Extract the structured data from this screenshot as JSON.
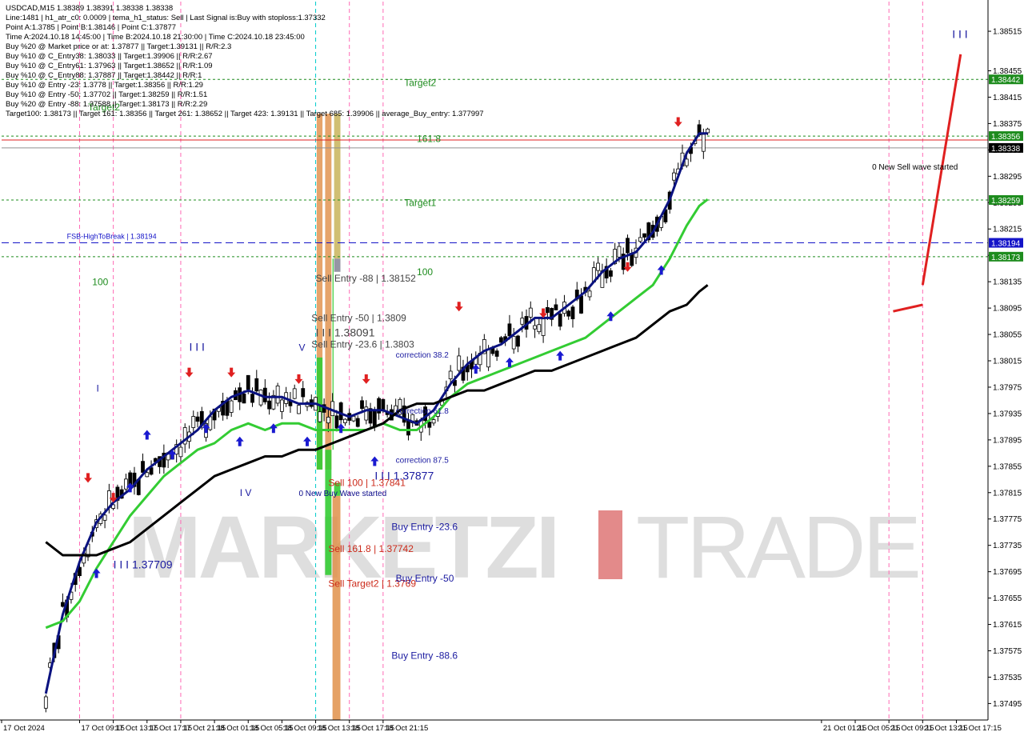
{
  "info_panel": {
    "lines": [
      "USDCAD,M15  1.38389 1.38391 1.38338 1.38338",
      "Line:1481  |  h1_atr_c0: 0.0009  |  tema_h1_status: Sell  |  Last Signal is:Buy with stoploss:1.37332",
      "Point A:1.3785  |  Point B:1.38146  |  Point C:1.37877",
      "Time A:2024.10.18 14:45:00  |  Time B:2024.10.18 21:30:00  |  Time C:2024.10.18 23:45:00",
      "Buy %20 @ Market price or at: 1.37877  ||  Target:1.39131  ||  R/R:2.3",
      "Buy %10 @ C_Entry38: 1.38033  ||  Target:1.39906  ||  R/R:2.67",
      "Buy %10 @ C_Entry61: 1.37963  ||  Target:1.38652  ||  R/R:1.09",
      "Buy %10 @ C_Entry88: 1.37887  ||  Target:1.38442  ||  R/R:1",
      "Buy %10 @ Entry -23: 1.3778  ||  Target:1.38356  ||  R/R:1.29",
      "Buy %10 @ Entry -50: 1.37702  ||  Target:1.38259  ||  R/R:1.51",
      "Buy %20 @ Entry -88: 1.37588  ||  Target:1.38173  ||  R/R:2.29",
      "Target100: 1.38173  ||  Target 161: 1.38356  ||  Target 261: 1.38652  ||  Target 423: 1.39131  ||  Target 685: 1.39906  ||  average_Buy_entry: 1.377997"
    ]
  },
  "watermark": {
    "left": "MARKETZI",
    "right": "TRADE"
  },
  "colors": {
    "accent_green": "#1e8c1e",
    "bright_green": "#33cc33",
    "sell_orange": "#e0904a",
    "olive": "#c8b45a",
    "navy": "#0a1280",
    "label_blue": "#1a1aa0",
    "label_red": "#cc2a1a",
    "fsb_blue": "#1414c8",
    "current_price_red": "#e02020"
  },
  "chart_data": {
    "type": "candlestick",
    "symbol": "USDCAD",
    "timeframe": "M15",
    "ohlc_header": {
      "open": 1.38389,
      "high": 1.38391,
      "low": 1.38338,
      "close": 1.38338
    },
    "current_price": "1.38338",
    "ylim": [
      1.3747,
      1.3856
    ],
    "y_ticks": [
      "1.38515",
      "1.38455",
      "1.38415",
      "1.38375",
      "1.38335",
      "1.38295",
      "1.38255",
      "1.38215",
      "1.38175",
      "1.38135",
      "1.38095",
      "1.38055",
      "1.38015",
      "1.37975",
      "1.37935",
      "1.37895",
      "1.37855",
      "1.37815",
      "1.37775",
      "1.37735",
      "1.37695",
      "1.37655",
      "1.37615",
      "1.37575",
      "1.37535",
      "1.37495"
    ],
    "x_ticks": [
      "17 Oct 2024",
      "17 Oct 09:15",
      "17 Oct 13:15",
      "17 Oct 17:15",
      "17 Oct 21:15",
      "18 Oct 01:15",
      "18 Oct 05:15",
      "18 Oct 09:15",
      "18 Oct 13:15",
      "18 Oct 17:15",
      "18 Oct 21:15",
      "21 Oct 01:15",
      "21 Oct 05:15",
      "21 Oct 09:15",
      "21 Oct 13:15",
      "21 Oct 17:15"
    ],
    "price_boxes": [
      {
        "label": "1.38442",
        "value": 1.38442,
        "color": "#1e8c1e"
      },
      {
        "label": "1.38356",
        "value": 1.38356,
        "color": "#1e8c1e"
      },
      {
        "label": "1.38338",
        "value": 1.38338,
        "color": "#000000"
      },
      {
        "label": "1.38259",
        "value": 1.38259,
        "color": "#1e8c1e"
      },
      {
        "label": "1.38194",
        "value": 1.38194,
        "color": "#1414c8"
      },
      {
        "label": "1.38173",
        "value": 1.38173,
        "color": "#1e8c1e"
      }
    ],
    "hlines": [
      {
        "value": 1.38442,
        "color": "#1e8c1e",
        "dash": "3,3"
      },
      {
        "value": 1.38356,
        "color": "#1e8c1e",
        "dash": "3,3"
      },
      {
        "value": 1.3835,
        "color": "#e02020",
        "dash": ""
      },
      {
        "value": 1.38338,
        "color": "#909090",
        "dash": ""
      },
      {
        "value": 1.38259,
        "color": "#1e8c1e",
        "dash": "3,3"
      },
      {
        "value": 1.38194,
        "color": "#1414c8",
        "dash": "9,5"
      },
      {
        "value": 1.38173,
        "color": "#1e8c1e",
        "dash": "3,3"
      }
    ],
    "zones": [
      {
        "from": 0.5,
        "to": 3.25,
        "hi": 1.3839,
        "lo": 1.3785,
        "color": "#e0904a",
        "opacity": 0.82
      },
      {
        "from": 4.5,
        "to": 7.5,
        "hi": 1.3839,
        "lo": 1.3785,
        "color": "#e0904a",
        "opacity": 0.82
      },
      {
        "from": 8.75,
        "to": 11.75,
        "hi": 1.3839,
        "lo": 1.3817,
        "color": "#c8b45a",
        "opacity": 0.85
      },
      {
        "from": 8.75,
        "to": 11.75,
        "hi": 1.3817,
        "lo": 1.3815,
        "color": "#8a8a9a",
        "opacity": 0.9
      },
      {
        "from": 0.5,
        "to": 3.25,
        "hi": 1.3802,
        "lo": 1.3785,
        "color": "#33cc33",
        "opacity": 0.9
      },
      {
        "from": 4.5,
        "to": 7.5,
        "hi": 1.3788,
        "lo": 1.3769,
        "color": "#33cc33",
        "opacity": 0.9
      },
      {
        "from": 8.0,
        "to": 8.5,
        "hi": 1.3817,
        "lo": 1.3788,
        "color": "#33cc33",
        "opacity": 0.9
      },
      {
        "from": 8.75,
        "to": 11.75,
        "hi": 1.3783,
        "lo": 1.3781,
        "color": "#33cc33",
        "opacity": 0.9
      },
      {
        "from": 8.0,
        "to": 11.75,
        "hi": 1.3781,
        "lo": 1.3747,
        "color": "#e0904a",
        "opacity": 0.85
      }
    ],
    "zone_times": {
      "base": "18 Oct 13:15",
      "step_hours": 0.25
    },
    "series": [
      {
        "name": "tema",
        "color": "#0a1280",
        "width": 3,
        "points": [
          [
            0,
            1.3751
          ],
          [
            4,
            1.3763
          ],
          [
            8,
            1.3771
          ],
          [
            12,
            1.3777
          ],
          [
            16,
            1.378
          ],
          [
            20,
            1.3782
          ],
          [
            24,
            1.3785
          ],
          [
            28,
            1.3787
          ],
          [
            32,
            1.3789
          ],
          [
            36,
            1.3791
          ],
          [
            40,
            1.3794
          ],
          [
            44,
            1.3796
          ],
          [
            48,
            1.3797
          ],
          [
            52,
            1.3796
          ],
          [
            56,
            1.3796
          ],
          [
            60,
            1.3795
          ],
          [
            64,
            1.3795
          ],
          [
            68,
            1.3794
          ],
          [
            72,
            1.3793
          ],
          [
            76,
            1.3794
          ],
          [
            80,
            1.3794
          ],
          [
            84,
            1.3793
          ],
          [
            88,
            1.3792
          ],
          [
            92,
            1.3794
          ],
          [
            96,
            1.3798
          ],
          [
            100,
            1.3801
          ],
          [
            104,
            1.3803
          ],
          [
            108,
            1.3804
          ],
          [
            112,
            1.3806
          ],
          [
            116,
            1.3808
          ],
          [
            120,
            1.3808
          ],
          [
            124,
            1.381
          ],
          [
            128,
            1.3812
          ],
          [
            132,
            1.3815
          ],
          [
            136,
            1.3817
          ],
          [
            140,
            1.3818
          ],
          [
            144,
            1.3821
          ],
          [
            148,
            1.3826
          ],
          [
            152,
            1.3833
          ],
          [
            155,
            1.3836
          ],
          [
            157,
            1.3836
          ]
        ]
      },
      {
        "name": "ema-slow",
        "color": "#33cc33",
        "width": 3,
        "points": [
          [
            0,
            1.3761
          ],
          [
            4,
            1.3762
          ],
          [
            8,
            1.3765
          ],
          [
            12,
            1.377
          ],
          [
            16,
            1.3774
          ],
          [
            20,
            1.3778
          ],
          [
            24,
            1.3781
          ],
          [
            28,
            1.3784
          ],
          [
            32,
            1.3786
          ],
          [
            36,
            1.3788
          ],
          [
            40,
            1.3789
          ],
          [
            44,
            1.3791
          ],
          [
            48,
            1.3792
          ],
          [
            52,
            1.3791
          ],
          [
            56,
            1.3792
          ],
          [
            60,
            1.3792
          ],
          [
            64,
            1.3791
          ],
          [
            68,
            1.3791
          ],
          [
            72,
            1.3791
          ],
          [
            76,
            1.3791
          ],
          [
            80,
            1.3792
          ],
          [
            84,
            1.3791
          ],
          [
            88,
            1.3791
          ],
          [
            92,
            1.3793
          ],
          [
            96,
            1.3796
          ],
          [
            100,
            1.3798
          ],
          [
            104,
            1.3799
          ],
          [
            108,
            1.38
          ],
          [
            112,
            1.3801
          ],
          [
            116,
            1.3802
          ],
          [
            120,
            1.3803
          ],
          [
            124,
            1.3804
          ],
          [
            128,
            1.3805
          ],
          [
            132,
            1.3807
          ],
          [
            136,
            1.3809
          ],
          [
            140,
            1.3811
          ],
          [
            144,
            1.3813
          ],
          [
            148,
            1.3817
          ],
          [
            152,
            1.3822
          ],
          [
            155,
            1.3825
          ],
          [
            157,
            1.3826
          ]
        ]
      },
      {
        "name": "sma-long",
        "color": "#000000",
        "width": 3,
        "points": [
          [
            0,
            1.3774
          ],
          [
            4,
            1.3772
          ],
          [
            8,
            1.3772
          ],
          [
            12,
            1.3772
          ],
          [
            16,
            1.3773
          ],
          [
            20,
            1.3774
          ],
          [
            24,
            1.3776
          ],
          [
            28,
            1.3778
          ],
          [
            32,
            1.378
          ],
          [
            36,
            1.3782
          ],
          [
            40,
            1.3784
          ],
          [
            44,
            1.3785
          ],
          [
            48,
            1.3786
          ],
          [
            52,
            1.3787
          ],
          [
            56,
            1.3787
          ],
          [
            60,
            1.3788
          ],
          [
            64,
            1.3788
          ],
          [
            68,
            1.3789
          ],
          [
            72,
            1.379
          ],
          [
            76,
            1.3791
          ],
          [
            80,
            1.3792
          ],
          [
            84,
            1.3794
          ],
          [
            88,
            1.3795
          ],
          [
            92,
            1.3795
          ],
          [
            96,
            1.3796
          ],
          [
            100,
            1.3797
          ],
          [
            104,
            1.3797
          ],
          [
            108,
            1.3798
          ],
          [
            112,
            1.3799
          ],
          [
            116,
            1.38
          ],
          [
            120,
            1.38
          ],
          [
            124,
            1.3801
          ],
          [
            128,
            1.3802
          ],
          [
            132,
            1.3803
          ],
          [
            136,
            1.3804
          ],
          [
            140,
            1.3805
          ],
          [
            144,
            1.3807
          ],
          [
            148,
            1.3809
          ],
          [
            152,
            1.381
          ],
          [
            155,
            1.3812
          ],
          [
            157,
            1.3813
          ]
        ]
      }
    ],
    "bar_times": {
      "base": "17 Oct 2024 05:15",
      "step_hours": 0.5
    },
    "candle_source": "generated",
    "annotations": [
      {
        "text": "Target2",
        "value": 1.38432,
        "at": "18 Oct 23:45",
        "color": "#1e8c1e",
        "size": 12
      },
      {
        "text": "Target2",
        "value": 1.38395,
        "at": "17 Oct 10:15",
        "color": "#1e8c1e",
        "size": 12
      },
      {
        "text": "161.8",
        "value": 1.38347,
        "at": "19 Oct 01:15",
        "color": "#1e8c1e",
        "size": 12
      },
      {
        "text": "Target1",
        "value": 1.3825,
        "at": "18 Oct 23:45",
        "color": "#1e8c1e",
        "size": 12
      },
      {
        "text": "100",
        "value": 1.38145,
        "at": "19 Oct 01:15",
        "color": "#1e8c1e",
        "size": 12
      },
      {
        "text": "100",
        "value": 1.3813,
        "at": "17 Oct 10:45",
        "color": "#1e8c1e",
        "size": 12
      },
      {
        "text": "FSB-HighToBreak  |  1.38194",
        "value": 1.382,
        "at": "17 Oct 07:45",
        "color": "#1414c8",
        "size": 9
      },
      {
        "text": "0 New Sell wave started",
        "value": 1.38305,
        "at": "21 Oct 07:15",
        "color": "#000000",
        "size": 10
      },
      {
        "text": "Sell Entry -88 | 1.38152",
        "value": 1.38135,
        "at": "18 Oct 13:15",
        "color": "#444444",
        "size": 12
      },
      {
        "text": "Sell Entry -50 | 1.3809",
        "value": 1.38075,
        "at": "18 Oct 12:45",
        "color": "#444444",
        "size": 12
      },
      {
        "text": "I I I  1.38091",
        "value": 1.38052,
        "at": "18 Oct 13:15",
        "color": "#444444",
        "size": 14
      },
      {
        "text": "Sell Entry -23.6 | 1.3803",
        "value": 1.38035,
        "at": "18 Oct 12:45",
        "color": "#444444",
        "size": 12
      },
      {
        "text": "Sell 100 | 1.37841",
        "value": 1.37825,
        "at": "18 Oct 14:45",
        "color": "#cc2a1a",
        "size": 12
      },
      {
        "text": "0 New Buy Wave started",
        "value": 1.3781,
        "at": "18 Oct 11:15",
        "color": "#0a0a8a",
        "size": 10
      },
      {
        "text": "Sell 161.8 | 1.37742",
        "value": 1.37725,
        "at": "18 Oct 14:45",
        "color": "#cc2a1a",
        "size": 12
      },
      {
        "text": "Sell Target2 | 1.3769",
        "value": 1.37672,
        "at": "18 Oct 14:45",
        "color": "#cc2a1a",
        "size": 12
      },
      {
        "text": "I I I  1.37877",
        "value": 1.37835,
        "at": "18 Oct 20:15",
        "color": "#1a1aa0",
        "size": 14
      },
      {
        "text": "Buy Entry -23.6",
        "value": 1.37758,
        "at": "18 Oct 22:15",
        "color": "#1a1aa0",
        "size": 12
      },
      {
        "text": "Buy Entry -50",
        "value": 1.3768,
        "at": "18 Oct 22:45",
        "color": "#1a1aa0",
        "size": 12
      },
      {
        "text": "Buy Entry -88.6",
        "value": 1.37563,
        "at": "18 Oct 22:15",
        "color": "#1a1aa0",
        "size": 12
      },
      {
        "text": "correction 38.2",
        "value": 1.3802,
        "at": "18 Oct 22:45",
        "color": "#1a1aa0",
        "size": 10
      },
      {
        "text": "correction 61.8",
        "value": 1.37935,
        "at": "18 Oct 22:45",
        "color": "#1a1aa0",
        "size": 10
      },
      {
        "text": "correction 87.5",
        "value": 1.3786,
        "at": "18 Oct 22:45",
        "color": "#1a1aa0",
        "size": 10
      },
      {
        "text": "I I I  1.37709",
        "value": 1.377,
        "at": "17 Oct 13:15",
        "color": "#1a1aa0",
        "size": 14
      },
      {
        "text": "I I I",
        "value": 1.3803,
        "at": "17 Oct 22:15",
        "color": "#1a1aa0",
        "size": 14
      },
      {
        "text": "I I I",
        "value": 1.38505,
        "at": "21 Oct 16:45",
        "color": "#1a1aa0",
        "size": 14
      },
      {
        "text": "V",
        "value": 1.3803,
        "at": "18 Oct 11:15",
        "color": "#1a1aa0",
        "size": 12
      },
      {
        "text": "I",
        "value": 1.37968,
        "at": "17 Oct 11:15",
        "color": "#1a1aa0",
        "size": 12
      },
      {
        "text": "I V",
        "value": 1.3781,
        "at": "18 Oct 04:15",
        "color": "#1a1aa0",
        "size": 12
      }
    ]
  }
}
